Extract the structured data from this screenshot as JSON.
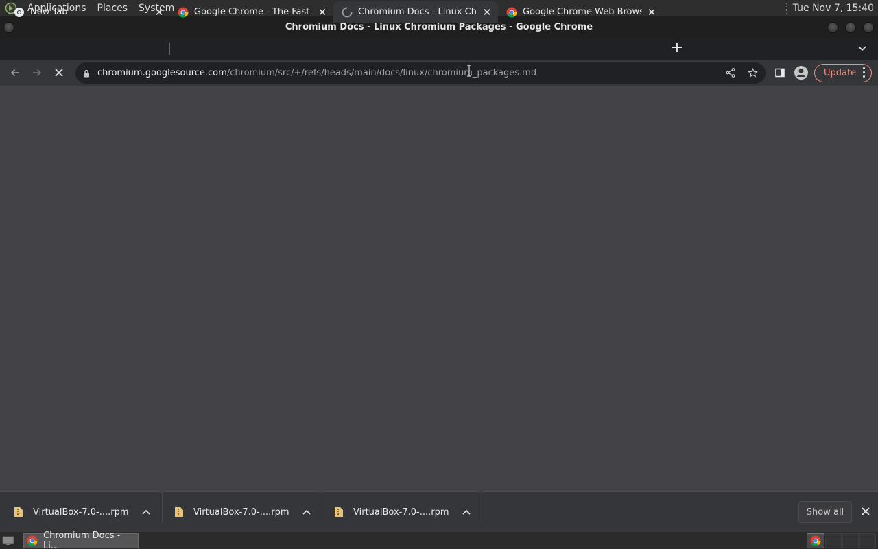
{
  "system_panel": {
    "menus": [
      "Applications",
      "Places",
      "System"
    ],
    "clock": "Tue Nov 7, 15:40"
  },
  "window": {
    "title": "Chromium Docs - Linux Chromium Packages - Google Chrome"
  },
  "tabs": [
    {
      "title": "New Tab",
      "favicon": "chrome-newtab-icon",
      "active": false
    },
    {
      "title": "Google Chrome - The Fast & S",
      "favicon": "chrome-logo-icon",
      "active": false
    },
    {
      "title": "Chromium Docs - Linux Chrom",
      "favicon": "loading-spinner-icon",
      "active": true
    },
    {
      "title": "Google Chrome Web Browser",
      "favicon": "chrome-logo-icon",
      "active": false
    }
  ],
  "toolbar": {
    "url_host": "chromium.googlesource.com",
    "url_path": "/chromium/src/+/refs/heads/main/docs/linux/chromium_packages.md",
    "update_label": "Update"
  },
  "downloads": {
    "items": [
      {
        "filename": "VirtualBox-7.0-....rpm"
      },
      {
        "filename": "VirtualBox-7.0-....rpm"
      },
      {
        "filename": "VirtualBox-7.0-....rpm"
      }
    ],
    "show_all_label": "Show all"
  },
  "taskbar": {
    "task_label": "Chromium Docs - Li..."
  },
  "colors": {
    "content_bg": "#434347",
    "toolbar_bg": "#35363a",
    "tabstrip_bg": "#202124",
    "update_accent": "#f28b82"
  }
}
